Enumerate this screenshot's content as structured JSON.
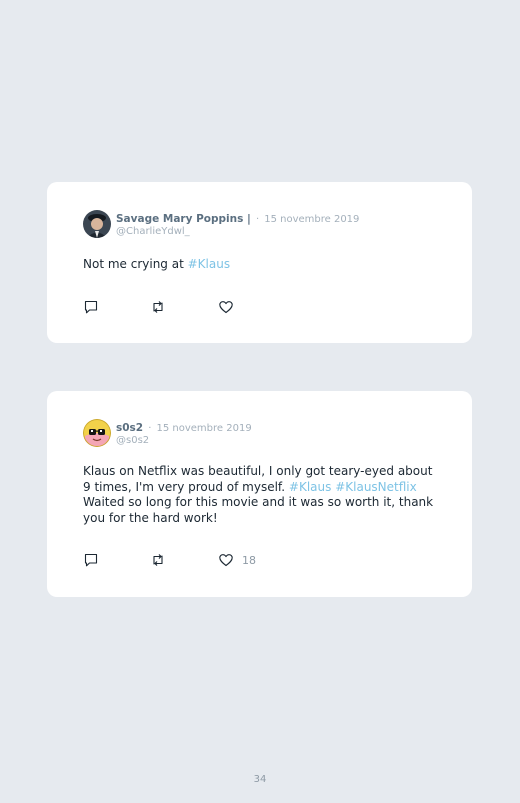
{
  "tweets": [
    {
      "name": "Savage Mary Poppins |",
      "sep": "·",
      "date": "15 novembre 2019",
      "handle": "@CharlieYdwl_",
      "text_parts": [
        "Not me crying at ",
        "#Klaus"
      ],
      "likes": ""
    },
    {
      "name": "s0s2",
      "sep": "·",
      "date": "15 novembre 2019",
      "handle": "@s0s2",
      "text_parts": [
        "Klaus on Netflix was beautiful, I only got teary-eyed about 9 times, I'm very proud of myself. ",
        "#Klaus",
        " ",
        "#KlausNetflix",
        "Waited so long for this movie and it was so worth it, thank you for the hard work!"
      ],
      "likes": "18"
    }
  ],
  "page_number": "34",
  "icons": {
    "reply": "speech-bubble-icon",
    "retweet": "retweet-icon",
    "like": "heart-icon"
  },
  "colors": {
    "background": "#e6eaef",
    "card": "#ffffff",
    "hashtag": "#7ec3e5",
    "muted": "#a4b0bb"
  }
}
